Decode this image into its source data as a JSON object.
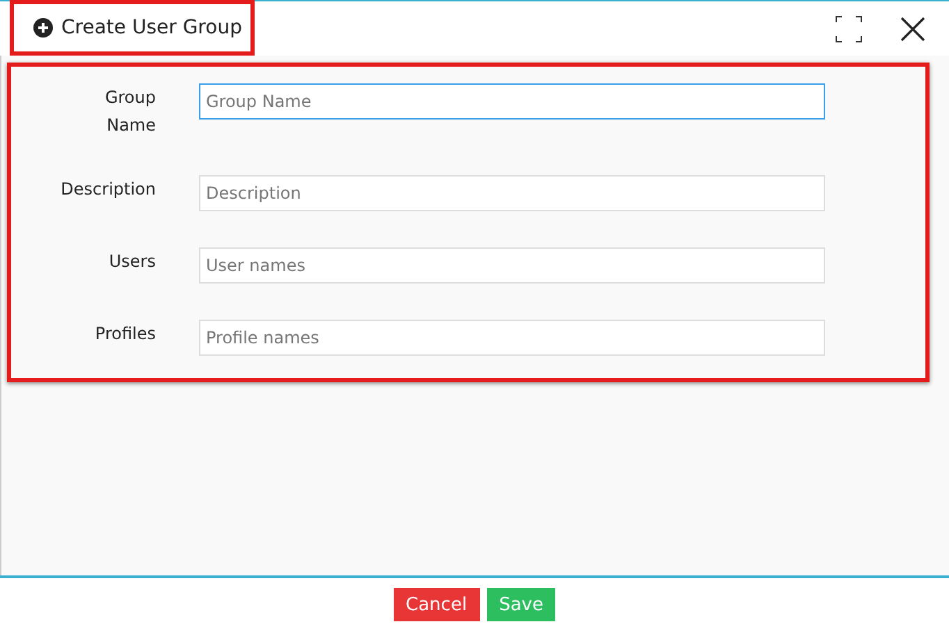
{
  "dialog": {
    "title": "Create User Group",
    "title_highlighted": true
  },
  "form": {
    "highlighted": true,
    "fields": [
      {
        "label": "Group Name",
        "placeholder": "Group Name",
        "focused": true
      },
      {
        "label": "Description",
        "placeholder": "Description",
        "focused": false
      },
      {
        "label": "Users",
        "placeholder": "User names",
        "focused": false
      },
      {
        "label": "Profiles",
        "placeholder": "Profile names",
        "focused": false
      }
    ]
  },
  "buttons": [
    {
      "label": "Cancel",
      "kind": "cancel"
    },
    {
      "label": "Save",
      "kind": "save"
    }
  ]
}
